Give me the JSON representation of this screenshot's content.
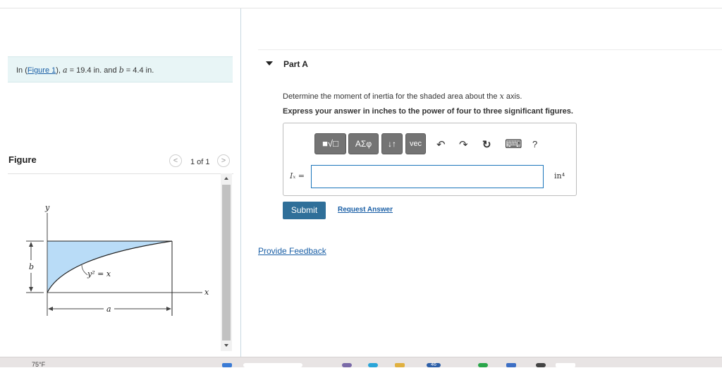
{
  "problem": {
    "intro": "In (",
    "figure_link": "Figure 1",
    "mid": "), ",
    "a_var": "a",
    "a_value": " = 19.4 in. and ",
    "b_var": "b",
    "b_value": " = 4.4 in."
  },
  "figure_panel": {
    "title": "Figure",
    "pager": "1 of 1",
    "prev_glyph": "<",
    "next_glyph": ">",
    "labels": {
      "y_axis": "y",
      "x_axis": "x",
      "b": "b",
      "a": "a",
      "curve": "y² = x"
    },
    "colors": {
      "fill": "#b9dcf7",
      "line": "#222222"
    }
  },
  "part": {
    "title": "Part A",
    "question_prefix": "Determine the moment of inertia for the shaded area about the ",
    "question_var": "x",
    "question_suffix": " axis.",
    "instruction": "Express your answer in inches to the power of four to three significant figures.",
    "answer_label": "Iₓ =",
    "answer_value": "",
    "units": "in⁴",
    "toolbar": {
      "templates": "■√□",
      "greek": "ΑΣφ",
      "arrows": "↓↑",
      "vec": "vec",
      "undo": "↶",
      "redo": "↷",
      "reset": "↻",
      "keyboard": "⌨",
      "help": "?"
    },
    "submit_label": "Submit",
    "request_label": "Request Answer"
  },
  "feedback_label": "Provide Feedback",
  "taskbar": {
    "temp": "75°F",
    "badge": "46"
  },
  "colors": {
    "accent": "#2f6f99",
    "link": "#1a5fa6",
    "info_bg": "#e8f5f6"
  }
}
